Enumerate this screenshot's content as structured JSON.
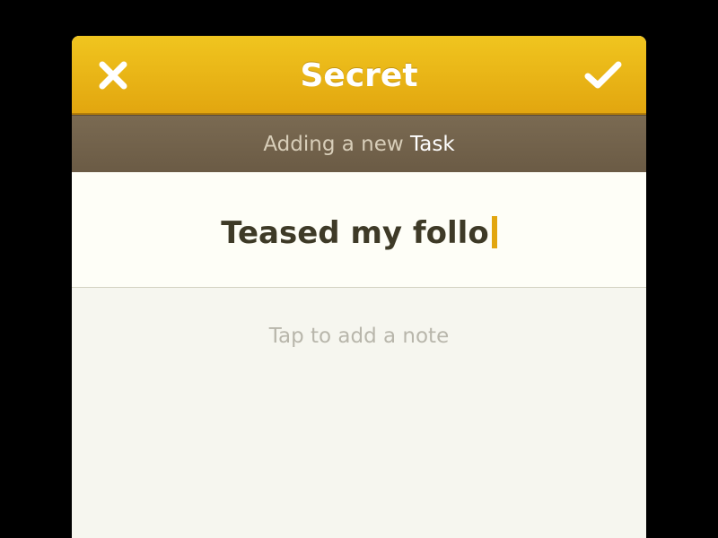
{
  "header": {
    "title": "Secret",
    "close_icon": "close-icon",
    "confirm_icon": "checkmark-icon",
    "accent_color": "#e8b618"
  },
  "subheader": {
    "prefix": "Adding a new",
    "entity": "Task"
  },
  "task": {
    "title_value": "Teased my follo"
  },
  "note": {
    "placeholder": "Tap to add a note"
  }
}
